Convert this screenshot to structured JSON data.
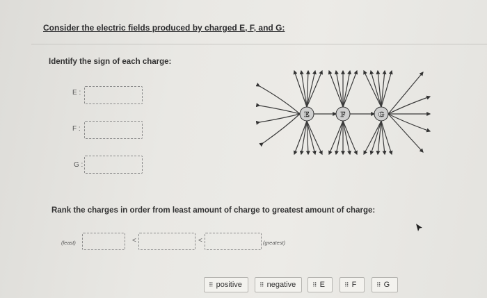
{
  "question": {
    "title": "Consider the electric fields produced by charged E, F, and G:",
    "sign_prompt": "Identify the sign of each charge:",
    "sign_labels": {
      "e": "E :",
      "f": "F :",
      "g": "G :"
    },
    "rank_prompt": "Rank the charges in order from least amount of charge to greatest amount of charge:",
    "rank_least": "(least)",
    "rank_greatest": "(greatest)",
    "rank_op": "<"
  },
  "figure": {
    "charges": [
      "E",
      "F",
      "G"
    ]
  },
  "tiles": [
    {
      "label": "positive"
    },
    {
      "label": "negative"
    },
    {
      "label": "E"
    },
    {
      "label": "F"
    },
    {
      "label": "G"
    }
  ],
  "grip_glyph": "⠿"
}
